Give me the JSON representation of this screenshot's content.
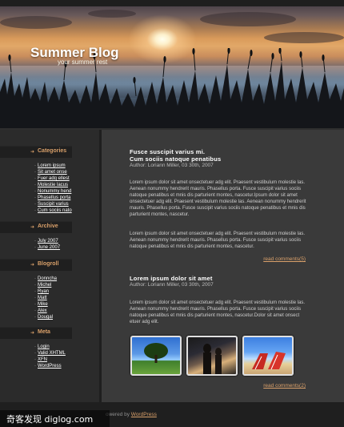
{
  "header": {
    "site_title": "Summer Blog",
    "tagline": "your summer rest"
  },
  "sidebar": {
    "categories": {
      "heading": "Categories",
      "items": [
        "Lorem ipsum",
        "Sit amet onse",
        "Fuer adq ellest",
        "Molestie lacus",
        "Nonummy hend",
        "Phasellus porta",
        "Suscipit varius",
        "Cum sociis nato"
      ]
    },
    "archive": {
      "heading": "Archive",
      "items": [
        "July 2007",
        "June 2007"
      ]
    },
    "blogroll": {
      "heading": "Blogroll",
      "items": [
        "Donncha",
        "Michel",
        "Ryan",
        "Matt",
        "Mike",
        "Alex",
        "Dougal"
      ]
    },
    "meta": {
      "heading": "Meta",
      "items": [
        "Login",
        "Valid XHTML",
        "XFN",
        "WordPress"
      ]
    }
  },
  "posts": [
    {
      "title_line1": "Fusce suscipit varius mi.",
      "title_line2": "Cum sociis natoque penatibus",
      "meta": "Author: Loriann Miller, 03 30th, 2007",
      "para1": "Lorem ipsum dolor sit amet onsectetuer adg elit. Praesent vestibulum molestie las. Aenean nonummy hendrerit mauris. Phasellus porta. Fusce suscipit varius sociis natoque penatibus et mnis dis parturient montes, nascetur.Ipsum dolor sit amet onsectetuer adg elit. Praesent vestibulum molestie las. Aenean nonummy hendrerit mauris. Phasellus porta. Fusce suscipit varius sociis natoque penatibus et mnis dis parturient montes, nascetur.",
      "para2": "Lorem ipsum dolor sit amet onsectetuer adg elit. Praesent vestibulum molestie las. Aenean nonummy hendrerit mauris. Phasellus porta. Fusce suscipit varius sociis natoque penatibus et mnis dis parturient montes, nascetur.",
      "read_more": "read comments(5)"
    },
    {
      "title_line1": "Lorem ipsum dolor sit amet",
      "meta": "Author: Loriann Miller, 03 30th, 2007",
      "para1": "Lorem ipsum dolor sit amet onsectetuer adg elit. Praesent vestibulum molestie las. Aenean nonummy hendrerit mauris. Phasellus porta. Fusce suscipit varius sociis natoque penatibus et mnis dis parturient montes, nascetur.Dolor sit amet onsect etuer adg elit.",
      "read_more": "read comments(2)"
    }
  ],
  "footer": {
    "powered_prefix": "owered by ",
    "powered_link": "WordPress"
  },
  "watermark": "奇客发现 diglog.com",
  "colors": {
    "accent": "#d9a06a",
    "background": "#2e2e2e",
    "content_bg": "#3a3a3a"
  }
}
